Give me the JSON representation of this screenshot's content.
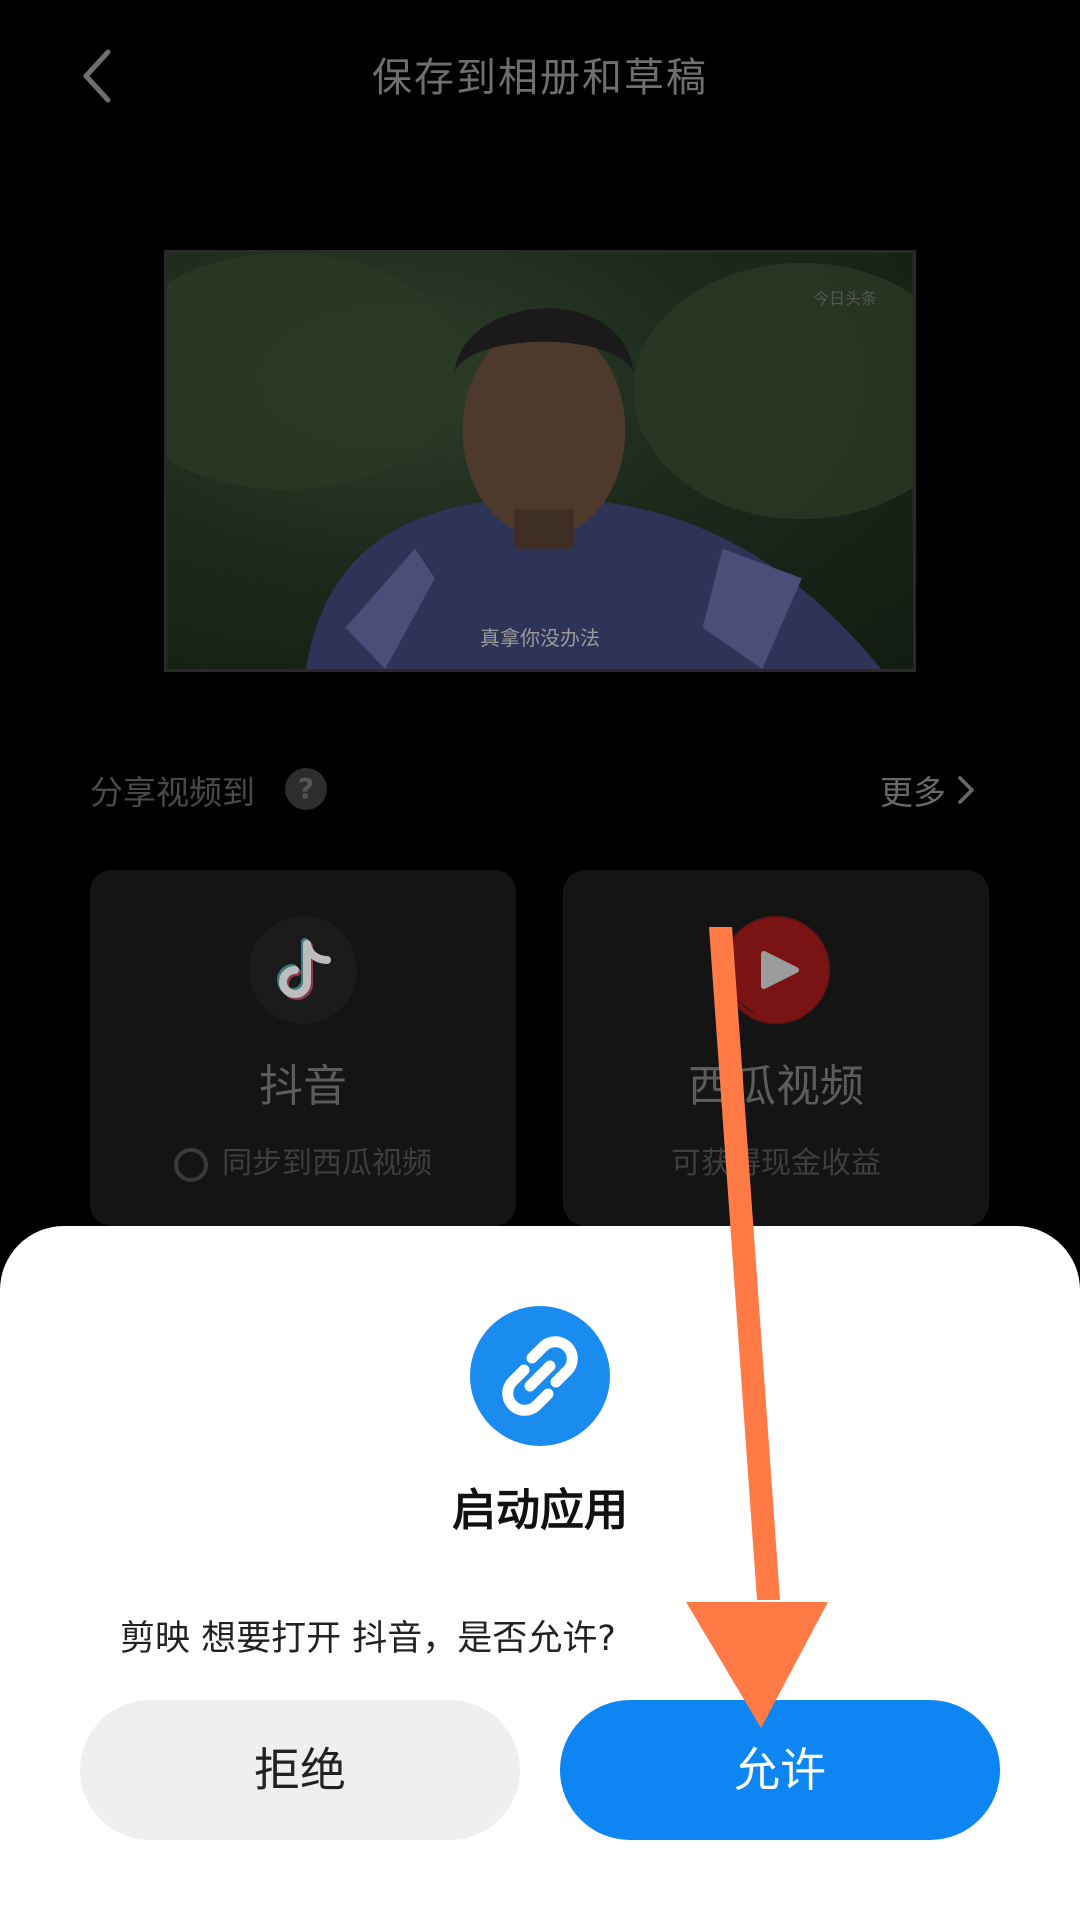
{
  "header": {
    "title": "保存到相册和草稿",
    "back_icon": "chevron-left-icon"
  },
  "preview": {
    "watermark": "今日头条",
    "subtitle": "真拿你没办法"
  },
  "share": {
    "label": "分享视频到",
    "help_icon": "question-icon",
    "help_glyph": "?",
    "more_label": "更多",
    "more_icon": "chevron-right-icon",
    "cards": [
      {
        "name": "抖音",
        "sub": "同步到西瓜视频",
        "icon": "douyin-logo-icon"
      },
      {
        "name": "西瓜视频",
        "sub": "可获得现金收益",
        "icon": "xigua-logo-icon"
      }
    ]
  },
  "dialog": {
    "icon": "link-icon",
    "title": "启动应用",
    "message": "剪映 想要打开 抖音，是否允许?",
    "deny_label": "拒绝",
    "allow_label": "允许"
  },
  "colors": {
    "background": "#000000",
    "allow_button": "#0D85F2",
    "deny_button": "#EFEFEF",
    "arrow": "#FF7A45",
    "link_icon_bg": "#1A8CF0"
  }
}
